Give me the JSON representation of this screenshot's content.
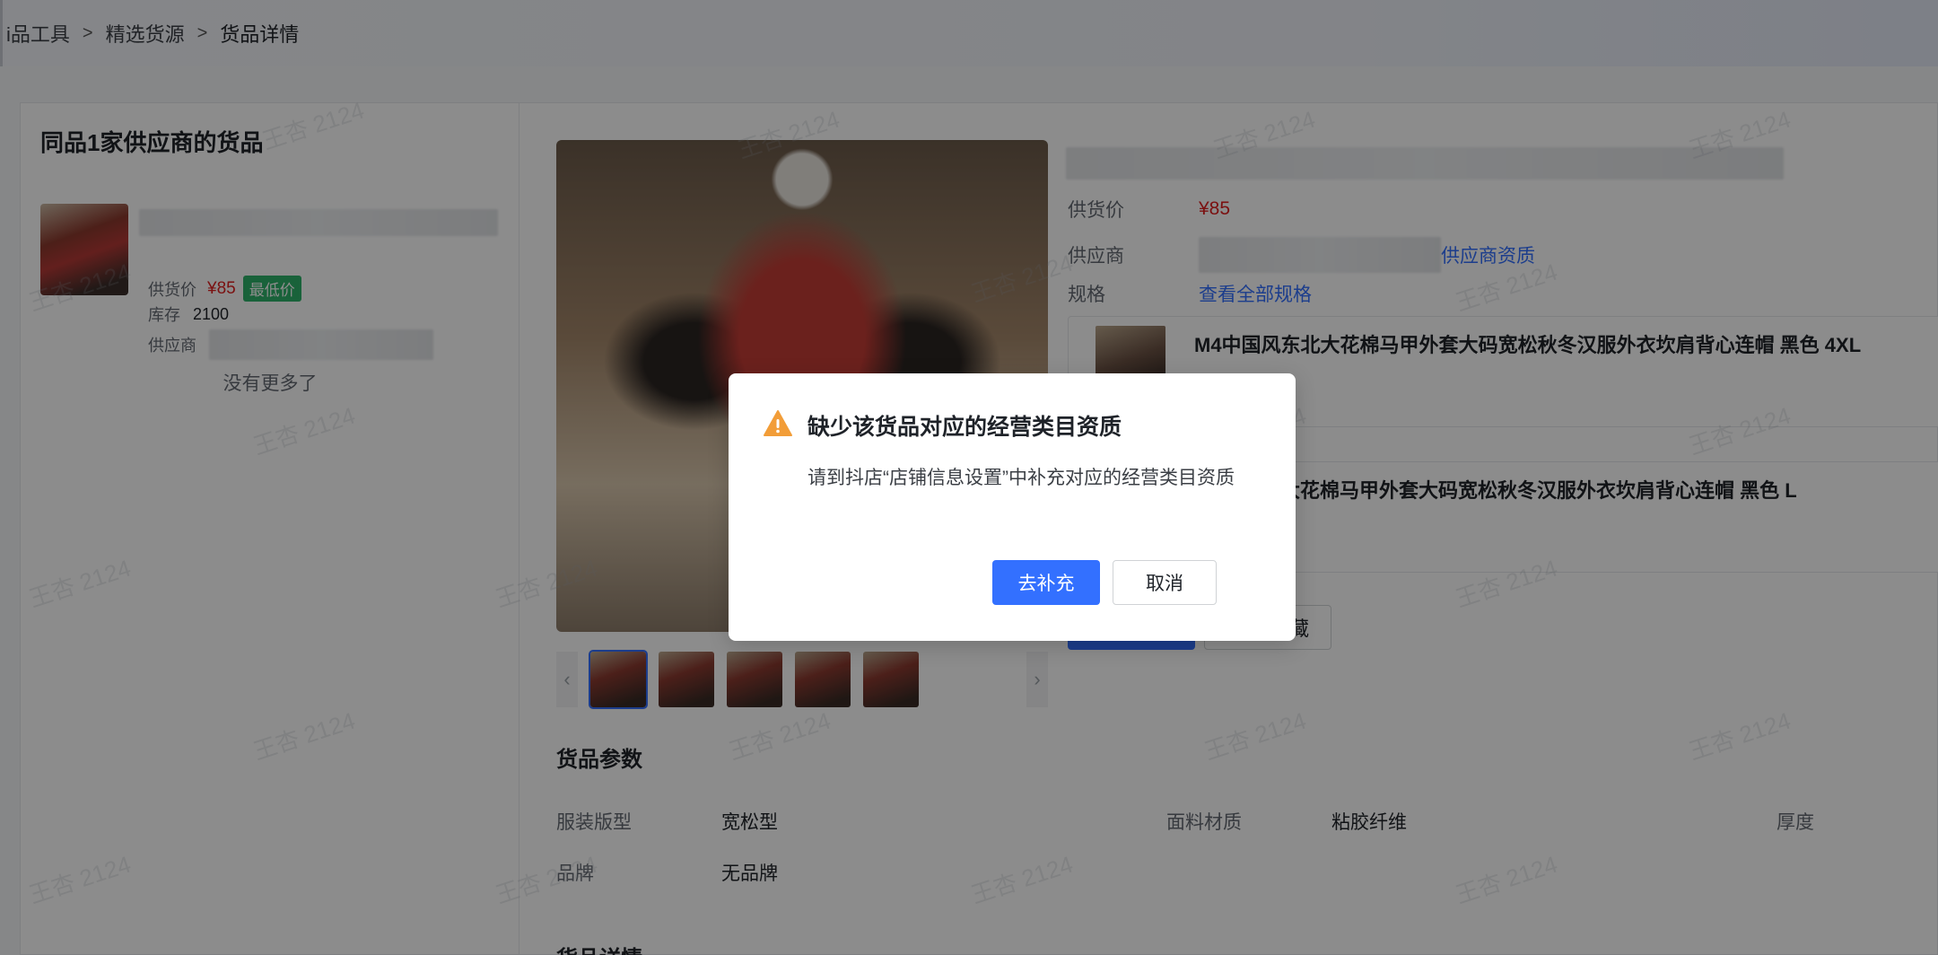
{
  "breadcrumb": {
    "items": [
      "i品工具",
      "精选货源",
      "货品详情"
    ],
    "separator": ">"
  },
  "left_panel": {
    "title": "同品1家供应商的货品",
    "supplier_card": {
      "price_label": "供货价",
      "price": "¥85",
      "badge": "最低价",
      "stock_label": "库存",
      "stock": "2100",
      "supplier_label": "供应商"
    },
    "no_more": "没有更多了"
  },
  "product_info": {
    "price_label": "供货价",
    "price": "¥85",
    "supplier_label": "供应商",
    "supplier_link": "供应商资质",
    "spec_label": "规格",
    "spec_link": "查看全部规格",
    "spec_items": [
      "M4中国风东北大花棉马甲外套大码宽松秋冬汉服外衣坎肩背心连帽 黑色 4XL",
      "东北大花棉马甲外套大码宽松秋冬汉服外衣坎肩背心连帽 黑色 L"
    ],
    "favorite_partial": "藏"
  },
  "params": {
    "title": "货品参数",
    "rows": [
      {
        "key": "服装版型",
        "value": "宽松型"
      },
      {
        "key": "面料材质",
        "value": "粘胶纤维"
      },
      {
        "key": "厚度",
        "value": ""
      },
      {
        "key": "品牌",
        "value": "无品牌"
      }
    ],
    "next_section": "货品详情"
  },
  "watermark": "王杏 2124",
  "modal": {
    "icon": "warning-icon",
    "title": "缺少该货品对应的经营类目资质",
    "body": "请到抖店“店铺信息设置”中补充对应的经营类目资质",
    "confirm": "去补充",
    "cancel": "取消"
  },
  "colors": {
    "primary": "#3370ff",
    "price": "#e02020",
    "badge": "#2fb36a",
    "warning": "#f29d38",
    "mask": "rgba(0,0,0,0.45)"
  }
}
